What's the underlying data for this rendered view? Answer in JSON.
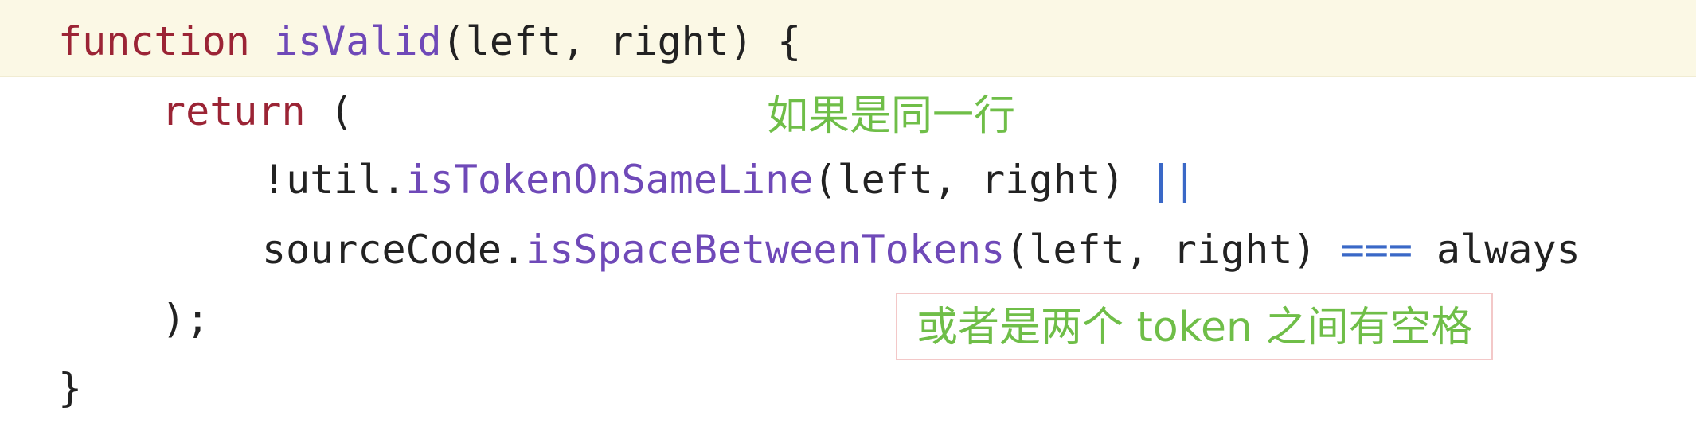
{
  "code": {
    "line1": {
      "kw_function": "function",
      "fn_name": "isValid",
      "params": "(left, right) {"
    },
    "line2": {
      "kw_return": "return",
      "open_paren": " ("
    },
    "line3": {
      "prefix": "!util.",
      "fn_name": "isTokenOnSameLine",
      "args": "(left, right) ",
      "operator": "||"
    },
    "line4": {
      "prefix": "sourceCode.",
      "fn_name": "isSpaceBetweenTokens",
      "args": "(left, right) ",
      "operator": "===",
      "suffix": " always"
    },
    "line5": {
      "text": ");"
    },
    "line6": {
      "text": "}"
    }
  },
  "annotations": {
    "same_line_note": "如果是同一行",
    "space_note": "或者是两个 token 之间有空格"
  },
  "colors": {
    "keyword": "#9b2435",
    "function_name": "#6f49b8",
    "operator": "#3a68c7",
    "annotation_text": "#6fbe48",
    "annotation_border": "#f3c8c8",
    "line_highlight": "#fbf8e5"
  }
}
